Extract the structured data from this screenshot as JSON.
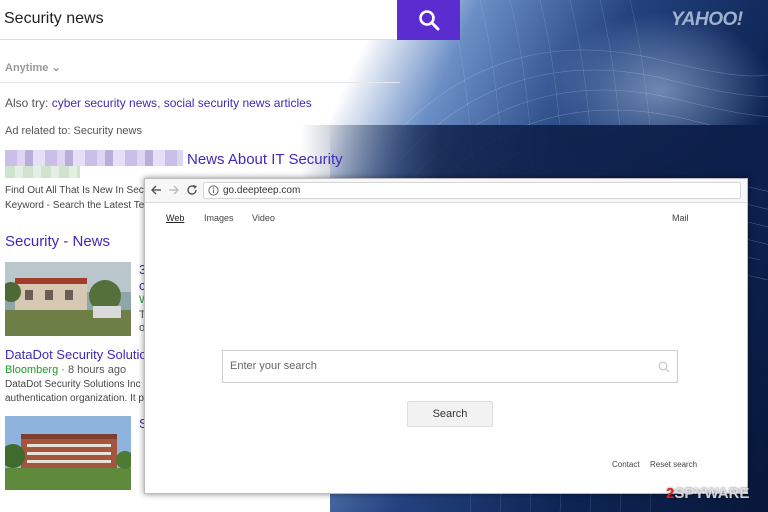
{
  "yahoo": {
    "search_query": "Security news",
    "logo_text": "YAHOO!",
    "anytime_label": "Anytime",
    "also_try_prefix": "Also try:",
    "also_try_link_1": "cyber security news",
    "also_try_separator": ",",
    "also_try_link_2": "social security news articles",
    "ad_related": "Ad related to: Security news",
    "ad_title": "News About IT Security",
    "ad_desc_line1": "Find Out All That Is New In Sec",
    "ad_desc_line2": "Keyword - Search the Latest Te",
    "section_title": "Security - News",
    "news_headline": "DataDot Security Solution",
    "news_source": "Bloomberg",
    "news_time": "· 8 hours ago",
    "news_snippet_line1": "DataDot Security Solutions Inc",
    "news_snippet_line2": "authentication organization. It p",
    "stub_1a": "3",
    "stub_1b": "c",
    "stub_1c": "W",
    "stub_1d": "T",
    "stub_1e": "o",
    "stub_2a": "S"
  },
  "browser": {
    "url": "go.deepteep.com",
    "nav_web": "Web",
    "nav_images": "Images",
    "nav_video": "Video",
    "nav_mail": "Mail",
    "search_placeholder": "Enter your search",
    "search_button": "Search",
    "footer_contact": "Contact",
    "footer_reset": "Reset search"
  },
  "watermark": {
    "digit": "2",
    "text": "SPYWARE"
  },
  "colors": {
    "yahoo_purple": "#5b2ccf",
    "link_purple": "#3d2bb8",
    "source_green": "#1a9c2a"
  }
}
